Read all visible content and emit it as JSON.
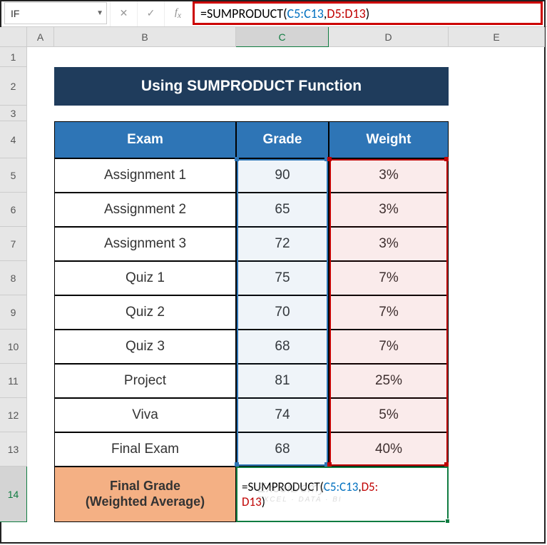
{
  "name_box": "IF",
  "formula_tokens": {
    "t0": "=SUMPRODUCT(",
    "t1": "C5:C13",
    "t2": ",",
    "t3": "D5:D13",
    "t4": ")"
  },
  "title": "Using SUMPRODUCT Function",
  "columns": {
    "A": "A",
    "B": "B",
    "C": "C",
    "D": "D",
    "E": "E"
  },
  "rows": [
    "1",
    "2",
    "3",
    "4",
    "5",
    "6",
    "7",
    "8",
    "9",
    "10",
    "11",
    "12",
    "13",
    "14"
  ],
  "headers": {
    "exam": "Exam",
    "grade": "Grade",
    "weight": "Weight"
  },
  "data": [
    {
      "exam": "Assignment 1",
      "grade": "90",
      "weight": "3%"
    },
    {
      "exam": "Assignment 2",
      "grade": "65",
      "weight": "3%"
    },
    {
      "exam": "Assignment 3",
      "grade": "72",
      "weight": "3%"
    },
    {
      "exam": "Quiz 1",
      "grade": "75",
      "weight": "7%"
    },
    {
      "exam": "Quiz 2",
      "grade": "70",
      "weight": "7%"
    },
    {
      "exam": "Quiz 3",
      "grade": "68",
      "weight": "7%"
    },
    {
      "exam": "Project",
      "grade": "81",
      "weight": "25%"
    },
    {
      "exam": "Viva",
      "grade": "74",
      "weight": "5%"
    },
    {
      "exam": "Final Exam",
      "grade": "68",
      "weight": "40%"
    }
  ],
  "final_row_label": "Final Grade (Weighted Average)",
  "active_cell_text": "=SUMPRODUCT(C5:C13,D5:D13)",
  "watermark": {
    "big": "ExcelDemy",
    "small": "EXCEL · DATA · BI"
  },
  "chart_data": {
    "type": "table",
    "title": "Using SUMPRODUCT Function",
    "columns": [
      "Exam",
      "Grade",
      "Weight"
    ],
    "rows": [
      [
        "Assignment 1",
        90,
        0.03
      ],
      [
        "Assignment 2",
        65,
        0.03
      ],
      [
        "Assignment 3",
        72,
        0.03
      ],
      [
        "Quiz 1",
        75,
        0.07
      ],
      [
        "Quiz 2",
        70,
        0.07
      ],
      [
        "Quiz 3",
        68,
        0.07
      ],
      [
        "Project",
        81,
        0.25
      ],
      [
        "Viva",
        74,
        0.05
      ],
      [
        "Final Exam",
        68,
        0.4
      ]
    ],
    "formula": "=SUMPRODUCT(C5:C13,D5:D13)",
    "result_label": "Final Grade (Weighted Average)"
  }
}
